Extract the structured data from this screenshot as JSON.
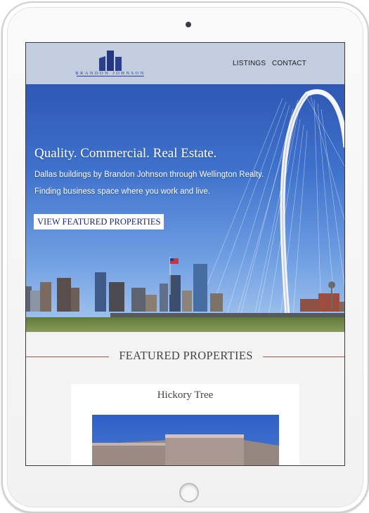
{
  "brand": {
    "name": "BRANDON JOHNSON"
  },
  "nav": {
    "links": [
      "LISTINGS",
      "CONTACT"
    ]
  },
  "hero": {
    "title": "Quality. Commercial. Real Estate.",
    "line1": "Dallas buildings by Brandon Johnson through Wellington Realty.",
    "line2": "Finding business space where you work and live.",
    "cta_label": "VIEW FEATURED PROPERTIES"
  },
  "featured": {
    "heading": "FEATURED PROPERTIES",
    "cards": [
      {
        "title": "Hickory Tree"
      }
    ]
  },
  "colors": {
    "navbar_bg": "#c3cde0",
    "brand_blue": "#2b3f8f",
    "section_rule": "#9c5a50",
    "page_bg": "#f3f3f3"
  },
  "icons": {
    "logo": "building-towers-icon"
  }
}
